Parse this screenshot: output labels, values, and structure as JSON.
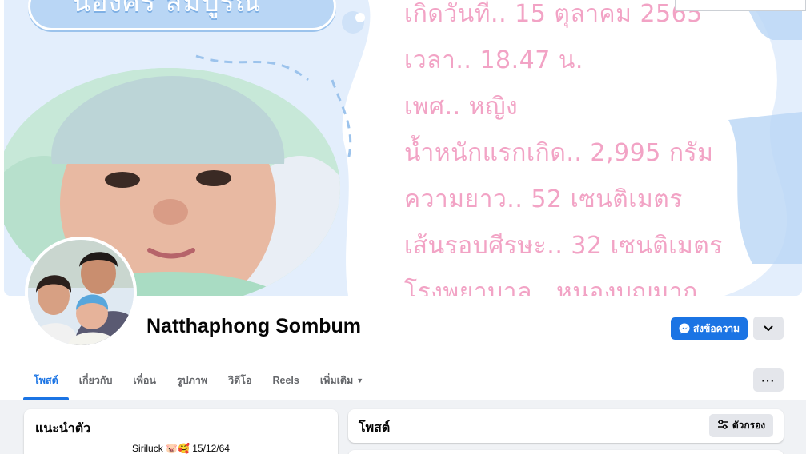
{
  "cover": {
    "title_text": "น้องศร สมบูรณ์",
    "info_lines": [
      "เกิดวันที่.. 15 ตุลาคม 2565",
      "เวลา.. 18.47 น.",
      "เพศ.. หญิง",
      "น้ำหนักแรกเกิด.. 2,995 กรัม",
      "ความยาว.. 52 เซนติเมตร",
      "เส้นรอบศีรษะ.. 32 เซนติเมตร",
      "โรงพยาบาล.. หนองบุญมาก"
    ],
    "colors": {
      "background": "#e3eefc",
      "info_text": "#f2a3c5",
      "pill": "#b9d6f5"
    }
  },
  "profile": {
    "name": "Natthaphong Sombum"
  },
  "actions": {
    "message_label": "ส่งข้อความ",
    "message_icon": "messenger-icon",
    "dropdown_icon": "chevron-down-icon",
    "more_label": "···"
  },
  "tabs": [
    {
      "label": "โพสต์",
      "active": true
    },
    {
      "label": "เกี่ยวกับ",
      "active": false
    },
    {
      "label": "เพื่อน",
      "active": false
    },
    {
      "label": "รูปภาพ",
      "active": false
    },
    {
      "label": "วิดีโอ",
      "active": false
    },
    {
      "label": "Reels",
      "active": false
    },
    {
      "label": "เพิ่มเติม",
      "active": false,
      "has_caret": true
    }
  ],
  "intro": {
    "title": "แนะนำตัว",
    "bio": "Siriluck 🐷🥰 15/12/64"
  },
  "posts": {
    "title": "โพสต์",
    "filter_label": "ตัวกรอง",
    "filter_icon": "sliders-icon"
  },
  "theme": {
    "accent": "#1b74e4",
    "page_bg": "#f0f2f5",
    "button_gray": "#e4e6eb"
  }
}
